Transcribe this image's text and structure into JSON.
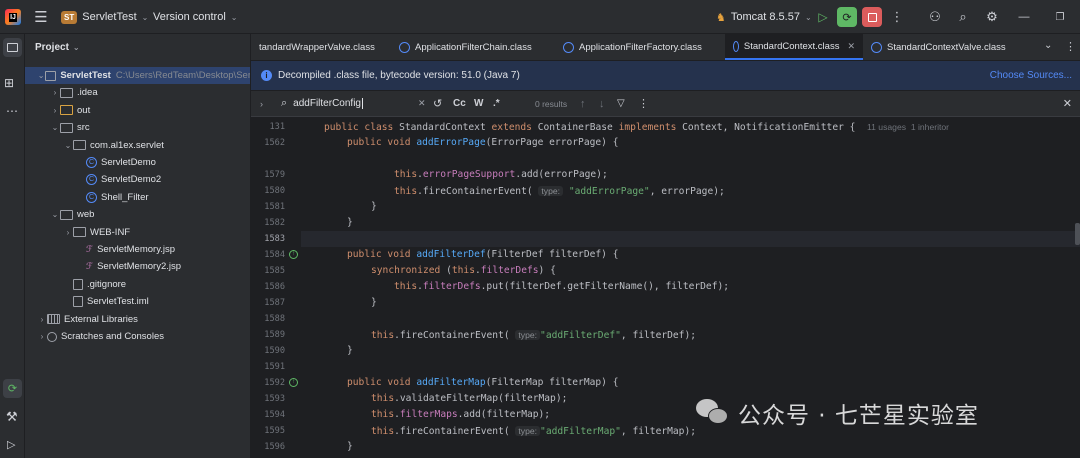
{
  "titlebar": {
    "logo_text": "IJ",
    "project_badge": "ST",
    "project_name": "ServletTest",
    "vcs_label": "Version control",
    "run_config": "Tomcat 8.5.57"
  },
  "project_panel": {
    "title": "Project",
    "items": [
      {
        "label": "ServletTest",
        "path": "C:\\Users\\RedTeam\\Desktop\\Ser",
        "icon": "folder-icon",
        "arrow": "expanded"
      },
      {
        "label": ".idea",
        "icon": "folder-icon",
        "arrow": "collapsed"
      },
      {
        "label": "out",
        "icon": "folder-icon",
        "arrow": "collapsed"
      },
      {
        "label": "src",
        "icon": "folder-icon",
        "arrow": "expanded"
      },
      {
        "label": "com.al1ex.servlet",
        "icon": "package-icon",
        "arrow": "expanded"
      },
      {
        "label": "ServletDemo",
        "icon": "class-icon"
      },
      {
        "label": "ServletDemo2",
        "icon": "class-icon"
      },
      {
        "label": "Shell_Filter",
        "icon": "class-icon"
      },
      {
        "label": "web",
        "icon": "folder-icon",
        "arrow": "expanded"
      },
      {
        "label": "WEB-INF",
        "icon": "folder-icon",
        "arrow": "collapsed"
      },
      {
        "label": "ServletMemory.jsp",
        "icon": "jsp-icon"
      },
      {
        "label": "ServletMemory2.jsp",
        "icon": "jsp-icon"
      },
      {
        "label": ".gitignore",
        "icon": "file-icon"
      },
      {
        "label": "ServletTest.iml",
        "icon": "file-icon"
      },
      {
        "label": "External Libraries",
        "icon": "library-icon",
        "arrow": "collapsed"
      },
      {
        "label": "Scratches and Consoles",
        "icon": "scratch-icon",
        "arrow": "collapsed"
      }
    ]
  },
  "tabs": [
    {
      "label": "tandardWrapperValve.class"
    },
    {
      "label": "ApplicationFilterChain.class"
    },
    {
      "label": "ApplicationFilterFactory.class"
    },
    {
      "label": "StandardContext.class",
      "active": true
    },
    {
      "label": "StandardContextValve.class"
    }
  ],
  "banner": {
    "text": "Decompiled .class file, bytecode version: 51.0 (Java 7)",
    "link": "Choose Sources..."
  },
  "search": {
    "query": "addFilterConfig",
    "results": "0 results",
    "case_label": "Cc",
    "word_label": "W",
    "regex_label": ".*"
  },
  "editor": {
    "class_usages": "11 usages",
    "class_inheritors": "1 inheritor",
    "line_numbers": [
      "131",
      "1562",
      "",
      "1579",
      "1580",
      "1581",
      "1582",
      "1583",
      "1584",
      "1585",
      "1586",
      "1587",
      "1588",
      "1589",
      "1590",
      "1591",
      "1592",
      "1593",
      "1594",
      "1595",
      "1596"
    ],
    "hint_type": "type:",
    "str_error_page": "\"addErrorPage\"",
    "str_filter_def": "\"addFilterDef\"",
    "str_filter_map": "\"addFilterMap\""
  },
  "watermark": {
    "text": "公众号 · 七芒星实验室"
  },
  "colors": {
    "accent": "#3574f0",
    "keyword": "#cf8e6d",
    "function": "#56a8f5",
    "field": "#c77dbb",
    "string": "#6aab73"
  }
}
